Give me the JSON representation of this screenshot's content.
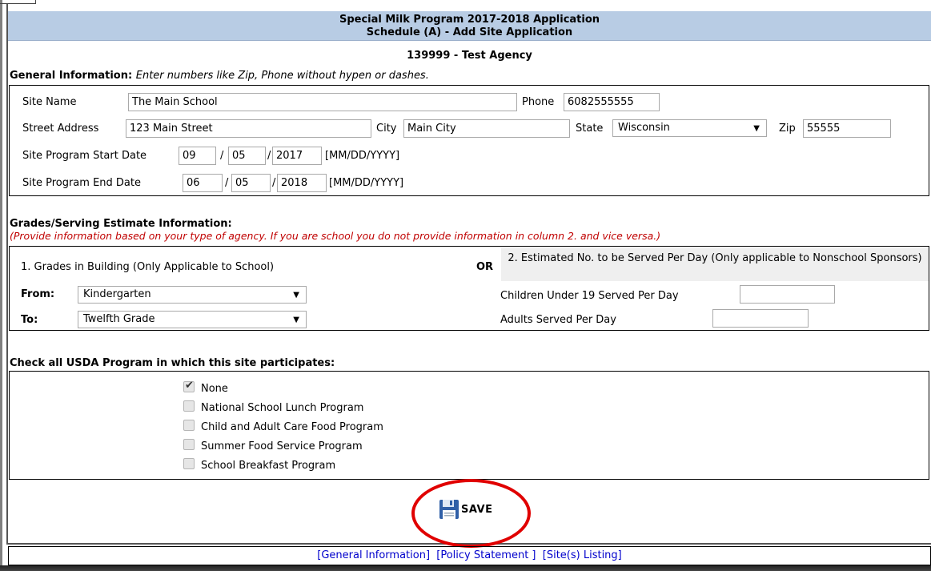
{
  "header": {
    "title_line1": "Special Milk Program 2017-2018 Application",
    "title_line2": "Schedule (A) - Add Site Application",
    "agency": "139999 - Test Agency"
  },
  "general": {
    "heading": "General Information:",
    "hint": "Enter numbers like Zip, Phone without hypen or dashes.",
    "site_name_label": "Site Name",
    "site_name": "The Main School",
    "phone_label": "Phone",
    "phone": "6082555555",
    "street_label": "Street Address",
    "street": "123 Main Street",
    "city_label": "City",
    "city": "Main City",
    "state_label": "State",
    "state": "Wisconsin",
    "zip_label": "Zip",
    "zip": "55555",
    "start_label": "Site Program Start Date",
    "start_mm": "09",
    "start_dd": "05",
    "start_yyyy": "2017",
    "end_label": "Site Program End Date",
    "end_mm": "06",
    "end_dd": "05",
    "end_yyyy": "2018",
    "slash": "/",
    "date_format": "[MM/DD/YYYY]"
  },
  "grades": {
    "heading": "Grades/Serving Estimate Information:",
    "hint": "(Provide information based on your type of agency. If you are school you do not provide information in column 2. and vice versa.)",
    "col1_header": "1. Grades in Building (Only Applicable to School)",
    "or_label": "OR",
    "col2_header": "2. Estimated No. to be Served Per Day (Only applicable to Nonschool Sponsors)",
    "from_label": "From:",
    "from_value": "Kindergarten",
    "to_label": "To:",
    "to_value": "Twelfth Grade",
    "children_label": "Children Under 19 Served Per Day",
    "children_value": "",
    "adults_label": "Adults Served Per Day",
    "adults_value": ""
  },
  "programs": {
    "heading": "Check all USDA Program in which this site participates:",
    "items": [
      {
        "label": "None",
        "checked": true
      },
      {
        "label": "National School Lunch Program",
        "checked": false
      },
      {
        "label": "Child and Adult Care Food Program",
        "checked": false
      },
      {
        "label": "Summer Food Service Program",
        "checked": false
      },
      {
        "label": "School Breakfast Program",
        "checked": false
      }
    ]
  },
  "save_label": "SAVE",
  "footer": {
    "link1": "[General Information]",
    "link2": "[Policy Statement ]",
    "link3": "[Site(s) Listing]"
  },
  "colors": {
    "header_band": "#b8cce4",
    "hint_red": "#c00000",
    "link_blue": "#0000cc",
    "highlight_ring": "#e00000"
  }
}
